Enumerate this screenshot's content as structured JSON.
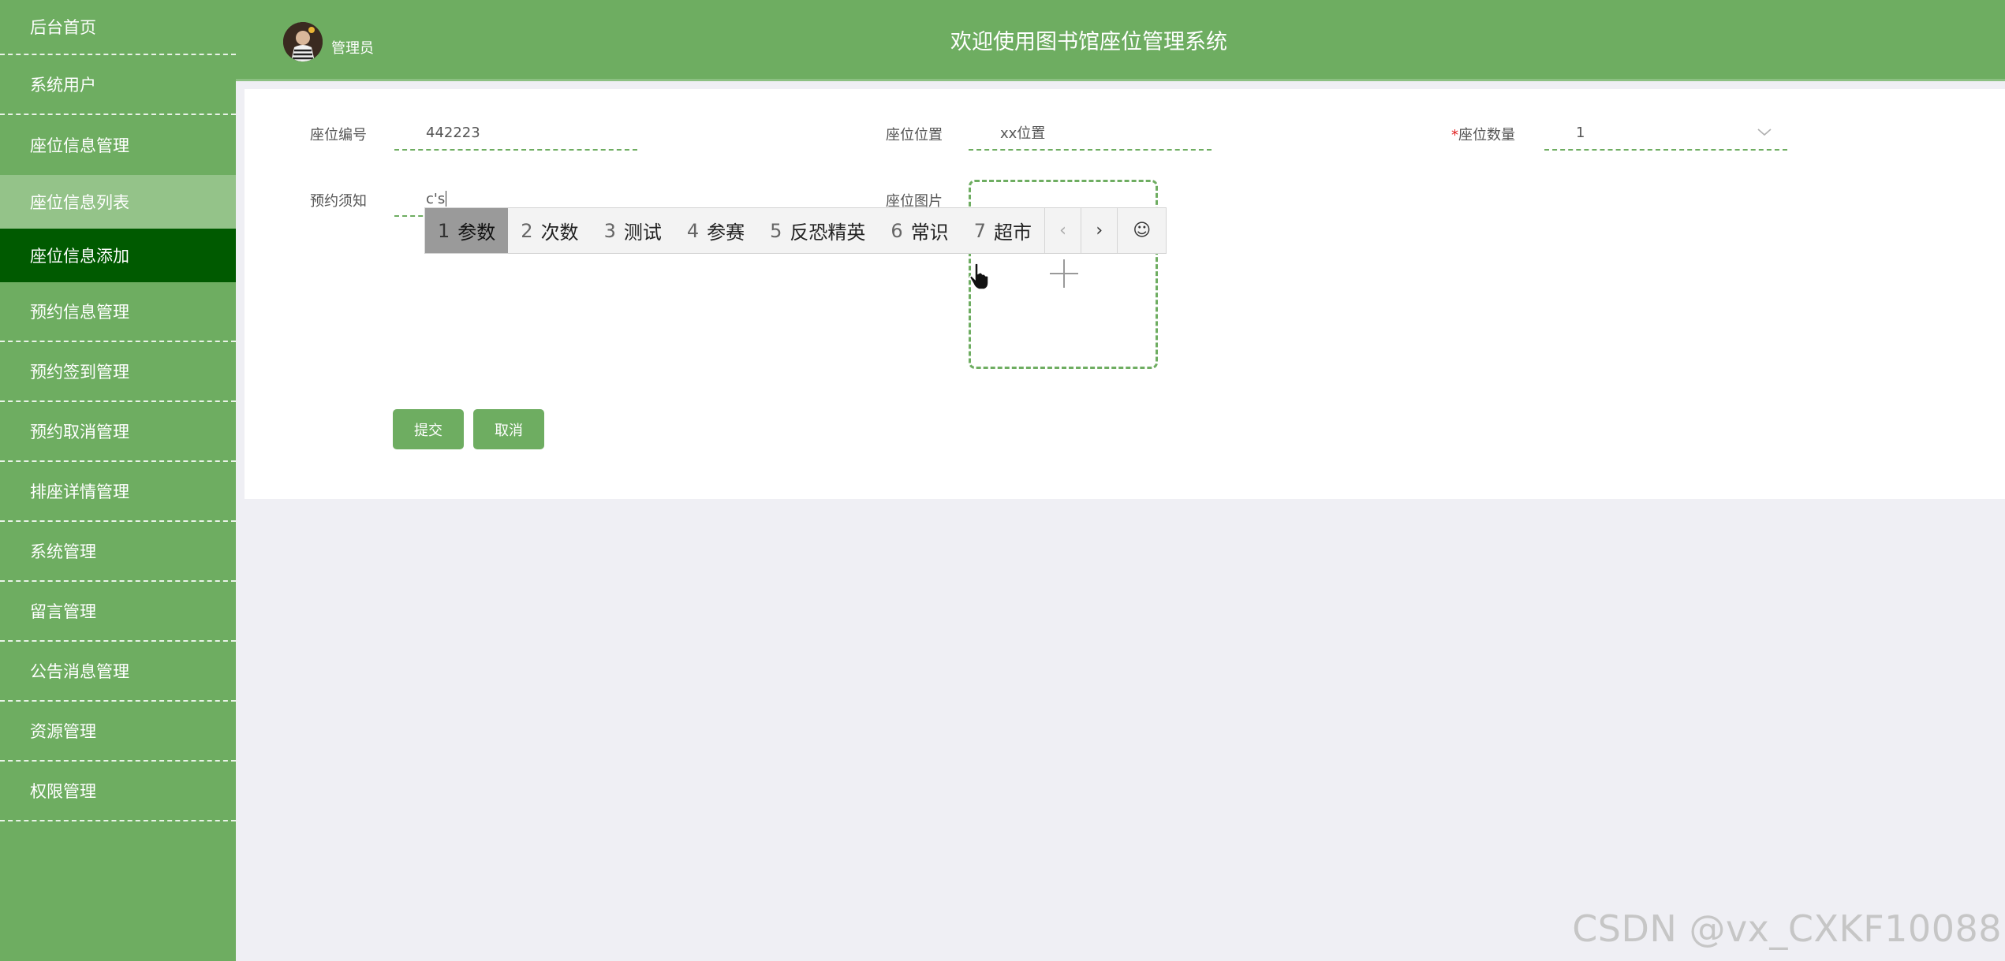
{
  "sidebar": {
    "items": [
      {
        "label": "后台首页"
      },
      {
        "label": "系统用户"
      },
      {
        "label": "座位信息管理"
      },
      {
        "label": "座位信息列表"
      },
      {
        "label": "座位信息添加"
      },
      {
        "label": "预约信息管理"
      },
      {
        "label": "预约签到管理"
      },
      {
        "label": "预约取消管理"
      },
      {
        "label": "排座详情管理"
      },
      {
        "label": "系统管理"
      },
      {
        "label": "留言管理"
      },
      {
        "label": "公告消息管理"
      },
      {
        "label": "资源管理"
      },
      {
        "label": "权限管理"
      }
    ]
  },
  "header": {
    "role": "管理员",
    "title": "欢迎使用图书馆座位管理系统"
  },
  "form": {
    "seat_no": {
      "label": "座位编号",
      "value": "442223"
    },
    "seat_location": {
      "label": "座位位置",
      "value": "xx位置"
    },
    "seat_count": {
      "label": "座位数量",
      "required_mark": "*",
      "value": "1"
    },
    "booking_notes": {
      "label": "预约须知",
      "value": "c's"
    },
    "seat_image": {
      "label": "座位图片"
    },
    "submit_label": "提交",
    "cancel_label": "取消"
  },
  "ime": {
    "candidates": [
      {
        "num": "1",
        "text": "参数"
      },
      {
        "num": "2",
        "text": "次数"
      },
      {
        "num": "3",
        "text": "测试"
      },
      {
        "num": "4",
        "text": "参赛"
      },
      {
        "num": "5",
        "text": "反恐精英"
      },
      {
        "num": "6",
        "text": "常识"
      },
      {
        "num": "7",
        "text": "超市"
      }
    ],
    "prev": "‹",
    "next": "›",
    "emoji": "☺"
  },
  "watermark": "CSDN @vx_CXKF10088",
  "colors": {
    "primary_green": "#6ead61",
    "active_menu": "#005a00",
    "light_menu": "#94c389",
    "required": "#e02020"
  }
}
